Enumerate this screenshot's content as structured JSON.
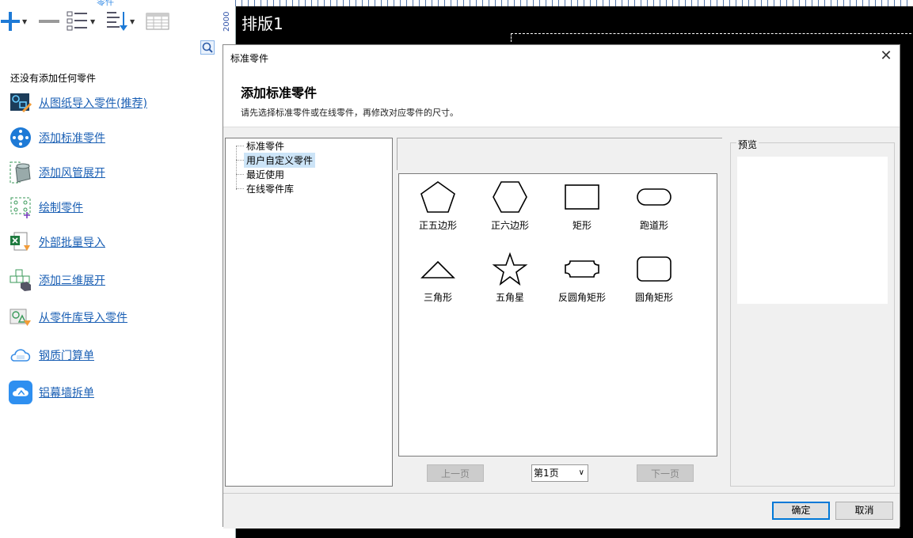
{
  "left_panel": {
    "toolbar_title": "零件",
    "empty_text": "还没有添加任何零件",
    "actions": [
      {
        "label": "从图纸导入零件(推荐)",
        "icon": "import-drawing-icon"
      },
      {
        "label": "添加标准零件",
        "icon": "standard-part-icon"
      },
      {
        "label": "添加风管展开",
        "icon": "duct-unfold-icon"
      },
      {
        "label": "绘制零件",
        "icon": "draw-part-icon"
      },
      {
        "label": "外部批量导入",
        "icon": "excel-import-icon"
      },
      {
        "label": "添加三维展开",
        "icon": "3d-unfold-icon"
      },
      {
        "label": "从零件库导入零件",
        "icon": "part-library-icon"
      },
      {
        "label": "钢质门算单",
        "icon": "steel-door-icon"
      },
      {
        "label": "铝幕墙拆单",
        "icon": "aluminum-curtain-wall-icon"
      }
    ]
  },
  "canvas": {
    "ruler_number": "2000",
    "layout_title": "排版1"
  },
  "dialog": {
    "title": "标准零件",
    "heading": "添加标准零件",
    "subtitle": "请先选择标准零件或在线零件，再修改对应零件的尺寸。",
    "tree": [
      {
        "label": "标准零件",
        "selected": false
      },
      {
        "label": "用户自定义零件",
        "selected": true
      },
      {
        "label": "最近使用",
        "selected": false
      },
      {
        "label": "在线零件库",
        "selected": false
      }
    ],
    "parts": [
      {
        "label": "正五边形",
        "shape": "pentagon"
      },
      {
        "label": "正六边形",
        "shape": "hexagon"
      },
      {
        "label": "矩形",
        "shape": "rectangle"
      },
      {
        "label": "跑道形",
        "shape": "racetrack"
      },
      {
        "label": "三角形",
        "shape": "triangle"
      },
      {
        "label": "五角星",
        "shape": "star"
      },
      {
        "label": "反圆角矩形",
        "shape": "inverse-rounded-rectangle"
      },
      {
        "label": "圆角矩形",
        "shape": "rounded-rectangle"
      }
    ],
    "pager": {
      "prev_label": "上一页",
      "page_value": "第1页",
      "next_label": "下一页"
    },
    "preview_label": "预览",
    "ok_label": "确定",
    "cancel_label": "取消"
  },
  "colors": {
    "link": "#1a5fb4",
    "accent": "#0078d7",
    "selection": "#cce4f7"
  }
}
